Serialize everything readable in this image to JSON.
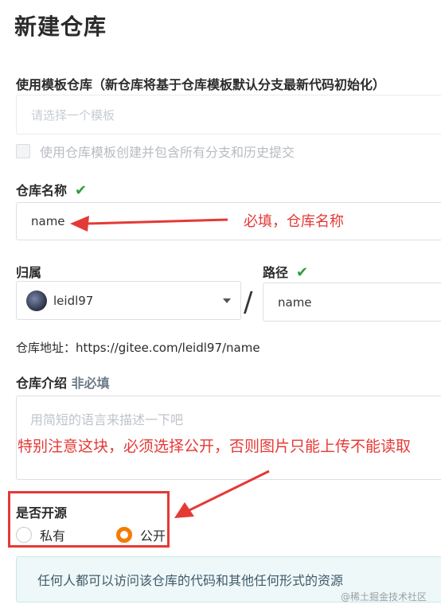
{
  "page_title": "新建仓库",
  "template": {
    "label": "使用模板仓库（新仓库将基于仓库模板默认分支最新代码初始化）",
    "placeholder": "请选择一个模板",
    "checkbox_label": "使用仓库模板创建并包含所有分支和历史提交"
  },
  "repo_name": {
    "label": "仓库名称",
    "value": "name",
    "check": "✔"
  },
  "owner": {
    "label": "归属",
    "value": "leidl97"
  },
  "path": {
    "label": "路径",
    "value": "name",
    "check": "✔",
    "separator": "/"
  },
  "address": "仓库地址：https://gitee.com/leidl97/name",
  "intro": {
    "label": "仓库介绍",
    "optional": "非必填",
    "placeholder": "用简短的语言来描述一下吧"
  },
  "visibility": {
    "label": "是否开源",
    "options": [
      "私有",
      "公开"
    ],
    "selected": "公开"
  },
  "info_text": "任何人都可以访问该仓库的代码和其他任何形式的资源",
  "annotations": {
    "required_name": "必填，仓库名称",
    "public_note": "特别注意这块，必须选择公开，否则图片只能上传不能读取",
    "color": "#e53935"
  },
  "watermark": "@稀土掘金技术社区",
  "colors": {
    "accent": "#f57c00",
    "check": "#2e9e3f",
    "info_bg": "#eef8f9"
  }
}
